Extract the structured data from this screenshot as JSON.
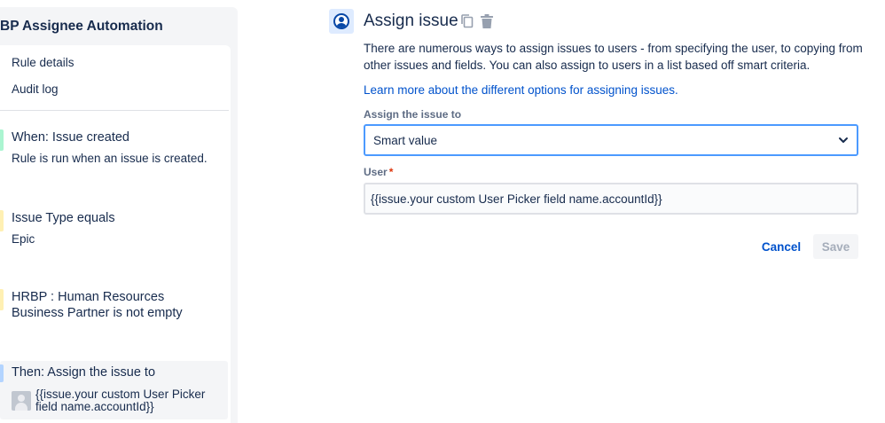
{
  "sidebar": {
    "rule_title": "BP Assignee Automation",
    "nav": [
      {
        "label": "Rule details"
      },
      {
        "label": "Audit log"
      }
    ],
    "steps": [
      {
        "title": "When: Issue created",
        "desc": "Rule is run when an issue is created.",
        "bar_color": "#abf5d1"
      },
      {
        "title": "Issue Type equals",
        "desc": "Epic",
        "bar_color": "#fff0b3"
      },
      {
        "title": "HRBP : Human Resources",
        "title2": "Business Partner is not empty",
        "bar_color": "#fff0b3"
      },
      {
        "title": "Then: Assign the issue to",
        "desc_line1": "{{issue.your custom User Picker",
        "desc_line2": "field name.accountId}}",
        "bar_color": "#b3d4ff"
      }
    ]
  },
  "main": {
    "icon": "user-circle-icon",
    "title": "Assign issue",
    "description": "There are numerous ways to assign issues to users - from specifying the user, to copying from other issues and fields. You can also assign to users in a list based off smart criteria.",
    "learn_more": "Learn more about the different options for assigning issues.",
    "assign_label": "Assign the issue to",
    "assign_value": "Smart value",
    "user_label": "User",
    "required_mark": "*",
    "user_value": "{{issue.your custom User Picker field name.accountId}}",
    "cancel": "Cancel",
    "save": "Save"
  },
  "colors": {
    "link": "#0052cc",
    "focus_border": "#4c9aff",
    "required": "#de350b"
  }
}
